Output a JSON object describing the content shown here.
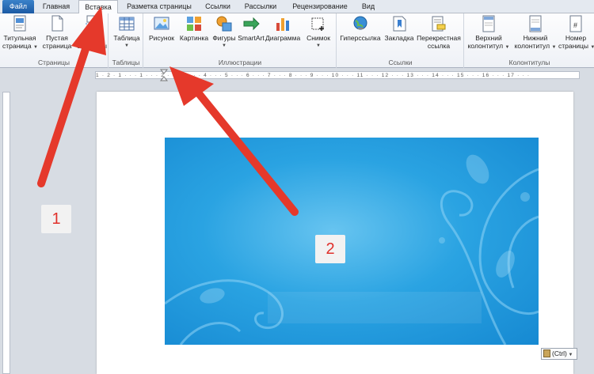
{
  "tabs": [
    {
      "label": "Файл"
    },
    {
      "label": "Главная"
    },
    {
      "label": "Вставка"
    },
    {
      "label": "Разметка страницы"
    },
    {
      "label": "Ссылки"
    },
    {
      "label": "Рассылки"
    },
    {
      "label": "Рецензирование"
    },
    {
      "label": "Вид"
    }
  ],
  "ribbon": {
    "pages": {
      "title": "Страницы",
      "cover": {
        "line1": "Титульная",
        "line2": "страница"
      },
      "blank": {
        "line1": "Пустая",
        "line2": "страница"
      },
      "break": {
        "line1": "Разрыв",
        "line2": "страницы"
      }
    },
    "tables": {
      "title": "Таблицы",
      "table": "Таблица"
    },
    "illustrations": {
      "title": "Иллюстрации",
      "picture": "Рисунок",
      "clipart": "Картинка",
      "shapes": "Фигуры",
      "smartart": "SmartArt",
      "chart": "Диаграмма",
      "screenshot": "Снимок"
    },
    "links": {
      "title": "Ссылки",
      "hyperlink": "Гиперссылка",
      "bookmark": "Закладка",
      "crossref": {
        "line1": "Перекрестная",
        "line2": "ссылка"
      }
    },
    "headerfooter": {
      "title": "Колонтитулы",
      "header": {
        "line1": "Верхний",
        "line2": "колонтитул"
      },
      "footer": {
        "line1": "Нижний",
        "line2": "колонтитул"
      },
      "pagenum": {
        "line1": "Номер",
        "line2": "страницы"
      }
    }
  },
  "ruler": {
    "corner": "L",
    "ticks": "1 · 2 · 1 · · · 1 · · · 2 · · · 3 · · · 4 · · · 5 · · · 6 · · · 7 · · · 8 · · · 9 · · · 10 · · · 11 · · · 12 · · · 13 · · · 14 · · · 15 · · · 16 · · · 17 · · ·"
  },
  "paste_options": {
    "label": "(Ctrl)"
  },
  "callouts": {
    "one": "1",
    "two": "2"
  },
  "colors": {
    "arrow": "#e5392b",
    "file_tab": "#2b6cb8",
    "picture_blue": "#2aa3e2"
  }
}
